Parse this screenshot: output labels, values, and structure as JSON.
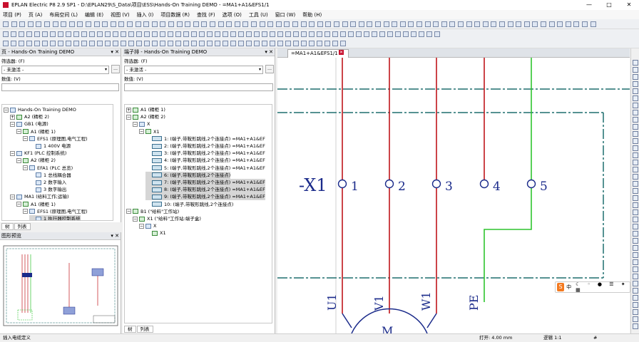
{
  "window": {
    "title": "EPLAN Electric P8 2.9 SP1 - D:\\EPLAN29\\S_Data\\项目\\ESS\\Hands-On Training DEMO - =MA1+A1&EFS1/1",
    "minimize": "—",
    "maximize": "□",
    "close": "✕"
  },
  "menu": [
    "项目 (P)",
    "页 (A)",
    "布局空间 (L)",
    "编辑 (E)",
    "视图 (V)",
    "插入 (I)",
    "项目数据 (R)",
    "查找 (F)",
    "选项 (O)",
    "工具 (U)",
    "窗口 (W)",
    "帮助 (H)"
  ],
  "page_nav": {
    "header": "页 - Hands-On Training DEMO",
    "filter_label": "筛选器: (F)",
    "filter_value": "- 未激活 -",
    "value_label": "数值: (V)",
    "tree": [
      {
        "depth": 0,
        "expander": "⊟",
        "label": "Hands-On Training DEMO",
        "icon": "project-icon"
      },
      {
        "depth": 1,
        "expander": "⊞",
        "label": "A2 (精柜 2)",
        "icon": "cabinet-icon"
      },
      {
        "depth": 1,
        "expander": "⊟",
        "label": "GB1 (电源)",
        "icon": "function-icon"
      },
      {
        "depth": 2,
        "expander": "⊟",
        "label": "A1 (精柜 1)",
        "icon": "cabinet-icon"
      },
      {
        "depth": 3,
        "expander": "⊟",
        "label": "EFS1 (原理图,电气工程)",
        "icon": "document-icon"
      },
      {
        "depth": 4,
        "expander": "",
        "label": "1 400V 电源",
        "icon": "page-icon"
      },
      {
        "depth": 1,
        "expander": "⊟",
        "label": "KF1 (PLC 控制系统)",
        "icon": "function-icon"
      },
      {
        "depth": 2,
        "expander": "⊟",
        "label": "A2 (精柜 2)",
        "icon": "cabinet-icon"
      },
      {
        "depth": 3,
        "expander": "⊟",
        "label": "EFA1 (PLC 总览)",
        "icon": "document-icon"
      },
      {
        "depth": 4,
        "expander": "",
        "label": "1 总线耦合器",
        "icon": "page-icon"
      },
      {
        "depth": 4,
        "expander": "",
        "label": "2 数字输入",
        "icon": "page-icon"
      },
      {
        "depth": 4,
        "expander": "",
        "label": "3 数字输出",
        "icon": "page-icon"
      },
      {
        "depth": 1,
        "expander": "⊟",
        "label": "MA1 (给料工作;运输)",
        "icon": "function-icon"
      },
      {
        "depth": 2,
        "expander": "⊟",
        "label": "A1 (精柜 1)",
        "icon": "cabinet-icon"
      },
      {
        "depth": 3,
        "expander": "⊟",
        "label": "EFS1 (原理图,电气工程)",
        "icon": "document-icon"
      },
      {
        "depth": 4,
        "expander": "",
        "label": "1 执行器控制系统",
        "icon": "page-icon",
        "selected": true
      }
    ],
    "tabs": [
      "树",
      "列表"
    ]
  },
  "preview": {
    "header": "图形预览"
  },
  "terminal_nav": {
    "header": "端子排 - Hands-On Training DEMO",
    "filter_label": "筛选器: (F)",
    "filter_value": "- 未激活 -",
    "value_label": "数值: (V)",
    "tree": [
      {
        "depth": 0,
        "expander": "⊞",
        "label": "A1 (精柜 1)",
        "icon": "cabinet-icon"
      },
      {
        "depth": 0,
        "expander": "⊟",
        "label": "A2 (精柜 2)",
        "icon": "cabinet-icon"
      },
      {
        "depth": 1,
        "expander": "⊟",
        "label": "X",
        "icon": "terminal-strip-icon"
      },
      {
        "depth": 2,
        "expander": "⊟",
        "label": "X1",
        "icon": "strip-definition-icon"
      },
      {
        "depth": 3,
        "expander": "",
        "label": "1: (端子,带鞍形跳线,2个连接点) =MA1+A1&EF",
        "icon": "terminal-icon"
      },
      {
        "depth": 3,
        "expander": "",
        "label": "2: (端子,带鞍形跳线,2个连接点) =MA1+A1&EF",
        "icon": "terminal-icon"
      },
      {
        "depth": 3,
        "expander": "",
        "label": "3: (端子,带鞍形跳线,2个连接点) =MA1+A1&EF",
        "icon": "terminal-icon"
      },
      {
        "depth": 3,
        "expander": "",
        "label": "4: (端子,带鞍形跳线,2个连接点) =MA1+A1&EF",
        "icon": "terminal-icon"
      },
      {
        "depth": 3,
        "expander": "",
        "label": "5: (端子,带鞍形跳线,2个连接点) =MA1+A1&EF",
        "icon": "terminal-icon"
      },
      {
        "depth": 3,
        "expander": "",
        "label": "6: (端子,带鞍形跳线,2个连接点)",
        "icon": "terminal-icon",
        "selected": true
      },
      {
        "depth": 3,
        "expander": "",
        "label": "7: (端子,带鞍形跳线,2个连接点) =MA1+A1&EF",
        "icon": "terminal-icon",
        "selected": true
      },
      {
        "depth": 3,
        "expander": "",
        "label": "8: (端子,带鞍形跳线,2个连接点) =MA1+A1&EF",
        "icon": "terminal-icon",
        "selected": true
      },
      {
        "depth": 3,
        "expander": "",
        "label": "9: (端子,带鞍形跳线,2个连接点) =MA1+A1&EF",
        "icon": "terminal-icon",
        "selected": true
      },
      {
        "depth": 3,
        "expander": "",
        "label": "10: (端子,带鞍形跳线,2个连接点)",
        "icon": "terminal-icon"
      },
      {
        "depth": 0,
        "expander": "⊟",
        "label": "B1 (\"给料\"工作站)",
        "icon": "cabinet-icon"
      },
      {
        "depth": 1,
        "expander": "⊟",
        "label": "X1 (\"给料\"工作站:端子盒)",
        "icon": "cabinet-icon"
      },
      {
        "depth": 2,
        "expander": "⊟",
        "label": "X",
        "icon": "terminal-strip-icon"
      },
      {
        "depth": 3,
        "expander": "",
        "label": "X1",
        "icon": "strip-definition-icon"
      }
    ],
    "tabs": [
      "树",
      "列表"
    ]
  },
  "document": {
    "tab": "=MA1+A1&EFS1/1",
    "strip_label": "-X1",
    "terminals": [
      "1",
      "2",
      "3",
      "4",
      "5"
    ],
    "wires": [
      "U1",
      "V1",
      "W1",
      "PE"
    ],
    "motor_label": "M",
    "colors": {
      "phase": "#c0151a",
      "pe": "#2ec42e",
      "symbol": "#1a2a8a",
      "frame": "#1f6f6f"
    }
  },
  "ime": {
    "logo": "S",
    "mode": "中"
  },
  "status": {
    "left": "插入电缆定义",
    "grid": "打开: 4.00 mm",
    "scale": "逻辑 1:1",
    "hash": "#"
  }
}
